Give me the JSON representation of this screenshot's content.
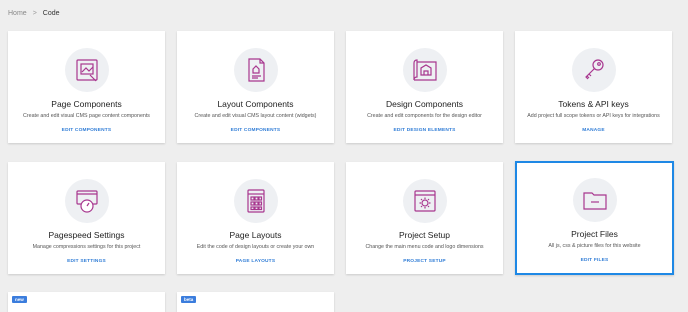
{
  "breadcrumb": {
    "home": "Home",
    "separator": ">",
    "current": "Code"
  },
  "accent": "#a8378f",
  "link_color": "#2f7cd6",
  "cards": [
    {
      "title": "Page Components",
      "desc": "Create and edit visual CMS page content components",
      "action": "EDIT COMPONENTS",
      "icon": "page-components-icon"
    },
    {
      "title": "Layout Components",
      "desc": "Create and edit visual CMS layout content (widgets)",
      "action": "EDIT COMPONENTS",
      "icon": "layout-components-icon"
    },
    {
      "title": "Design Components",
      "desc": "Create and edit components for the design editor",
      "action": "EDIT DESIGN ELEMENTS",
      "icon": "blueprint-icon"
    },
    {
      "title": "Tokens & API keys",
      "desc": "Add project full scope tokens or API keys for integrations",
      "action": "MANAGE",
      "icon": "key-icon"
    },
    {
      "title": "Pagespeed Settings",
      "desc": "Manage compressions settings for this project",
      "action": "EDIT SETTINGS",
      "icon": "pagespeed-icon"
    },
    {
      "title": "Page Layouts",
      "desc": "Edit the code of design layouts or create your own",
      "action": "PAGE LAYOUTS",
      "icon": "page-layouts-icon"
    },
    {
      "title": "Project Setup",
      "desc": "Change the main menu code and logo dimensions",
      "action": "PROJECT SETUP",
      "icon": "project-setup-icon"
    },
    {
      "title": "Project Files",
      "desc": "All js, css & picture files for this website",
      "action": "EDIT FILES",
      "icon": "folder-icon"
    }
  ],
  "badges": [
    {
      "label": "new",
      "color": "#3b7ddd"
    },
    {
      "label": "beta",
      "color": "#3b7ddd"
    }
  ]
}
